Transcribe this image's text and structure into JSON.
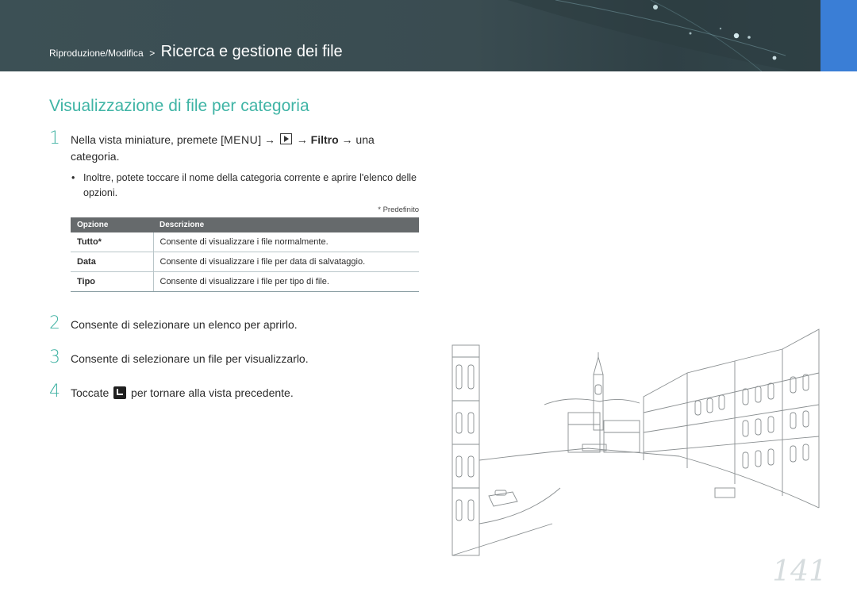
{
  "header": {
    "breadcrumb_parent": "Riproduzione/Modifica",
    "breadcrumb_separator": ">",
    "breadcrumb_current": "Ricerca e gestione dei file",
    "accent_color": "#3a7ed6",
    "band_color": "#3c5055"
  },
  "section": {
    "title": "Visualizzazione di file per categoria",
    "title_color": "#3fb4a5"
  },
  "steps": [
    {
      "num": "1",
      "text_before": "Nella vista miniature, premete [",
      "menu_key": "MENU",
      "text_mid": "] →",
      "icon": "play-icon",
      "arrow1": "→",
      "filter": "Filtro",
      "text_after": "→ una categoria."
    },
    {
      "num": "2",
      "text": "Consente di selezionare un elenco per aprirlo."
    },
    {
      "num": "3",
      "text": "Consente di selezionare un file per visualizzarlo."
    },
    {
      "num": "4",
      "text_before": "Toccate",
      "icon": "back-icon",
      "text_after": "per tornare alla vista precedente."
    }
  ],
  "bullet": {
    "marker": "•",
    "text": "Inoltre, potete toccare il nome della categoria corrente e aprire l'elenco delle opzioni."
  },
  "footnote": "* Predefinito",
  "table": {
    "headers": [
      "Opzione",
      "Descrizione"
    ],
    "rows": [
      {
        "option": "Tutto*",
        "description": "Consente di visualizzare i file normalmente."
      },
      {
        "option": "Data",
        "description": "Consente di visualizzare i file per data di salvataggio."
      },
      {
        "option": "Tipo",
        "description": "Consente di visualizzare i file per tipo di file."
      }
    ]
  },
  "page_number": "141"
}
